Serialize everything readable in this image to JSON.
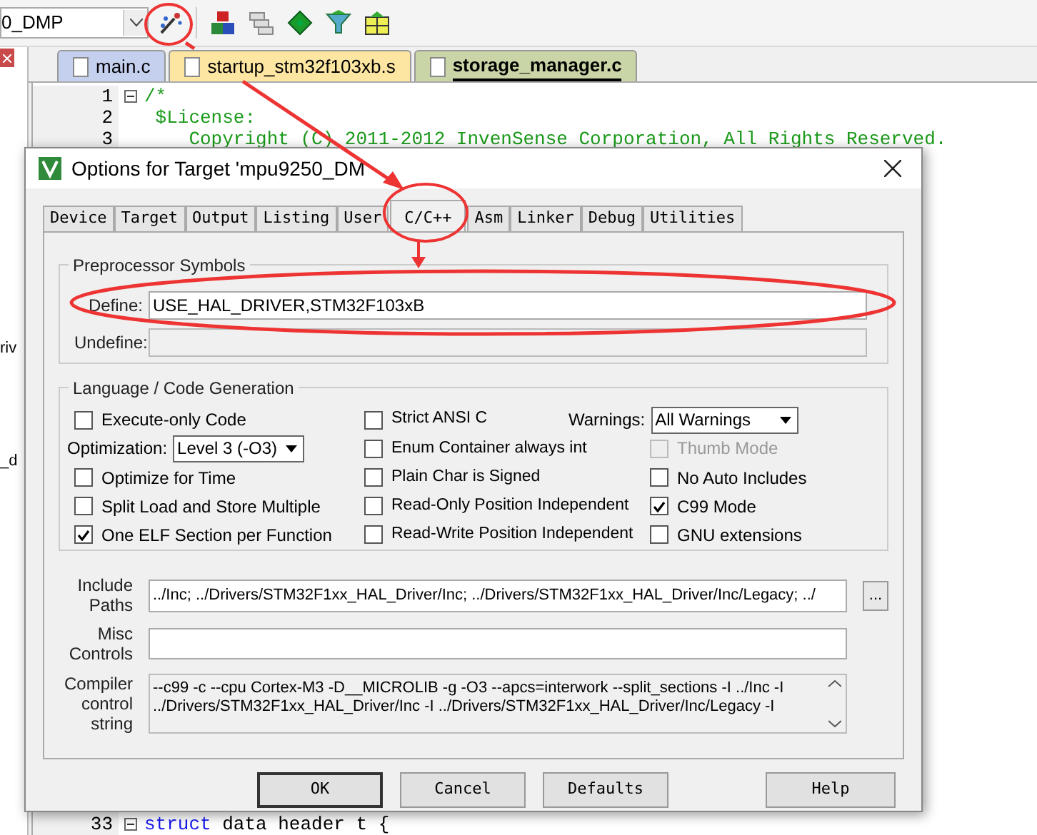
{
  "toolbar": {
    "target": "0_DMP"
  },
  "left_panel": {
    "fragments": [
      "riv",
      "_d"
    ]
  },
  "editor": {
    "tabs": [
      {
        "label": "main.c",
        "selected": false,
        "color": "#c5cfee"
      },
      {
        "label": "startup_stm32f103xb.s",
        "selected": false,
        "color": "#fde6a2"
      },
      {
        "label": "storage_manager.c",
        "selected": true,
        "color": "#c9d5a6"
      }
    ],
    "lines_top": [
      {
        "number": "1",
        "fold": true,
        "tokens": [
          {
            "text": "/*",
            "kind": "comment"
          }
        ]
      },
      {
        "number": "2",
        "fold": false,
        "tokens": [
          {
            "text": " $License:",
            "kind": "comment"
          }
        ]
      },
      {
        "number": "3",
        "fold": false,
        "tokens": [
          {
            "text": "    Copyright (C) 2011-2012 InvenSense Corporation, All Rights Reserved.",
            "kind": "comment"
          }
        ]
      }
    ],
    "lines_bottom": [
      {
        "number": "33",
        "fold": true,
        "tokens": [
          {
            "text": "struct",
            "kind": "keyword"
          },
          {
            "text": " data header t {",
            "kind": "plain"
          }
        ]
      }
    ]
  },
  "dialog": {
    "title": "Options for Target 'mpu9250_DM",
    "tabs": [
      {
        "label": "Device",
        "selected": false
      },
      {
        "label": "Target",
        "selected": false
      },
      {
        "label": "Output",
        "selected": false
      },
      {
        "label": "Listing",
        "selected": false
      },
      {
        "label": "User",
        "selected": false
      },
      {
        "label": "C/C++",
        "selected": true
      },
      {
        "label": "Asm",
        "selected": false
      },
      {
        "label": "Linker",
        "selected": false
      },
      {
        "label": "Debug",
        "selected": false
      },
      {
        "label": "Utilities",
        "selected": false
      }
    ],
    "preprocessor": {
      "title": "Preprocessor Symbols",
      "define_label": "Define:",
      "define_value": "USE_HAL_DRIVER,STM32F103xB",
      "undefine_label": "Undefine:"
    },
    "language": {
      "title": "Language / Code Generation",
      "columns": [
        [
          {
            "kind": "checkbox",
            "label": "Execute-only Code",
            "checked": false,
            "disabled": false
          },
          {
            "kind": "select",
            "label": "Optimization:",
            "value": "Level 3 (-O3)"
          },
          {
            "kind": "checkbox",
            "label": "Optimize for Time",
            "checked": false,
            "disabled": false
          },
          {
            "kind": "checkbox",
            "label": "Split Load and Store Multiple",
            "checked": false,
            "disabled": false
          },
          {
            "kind": "checkbox",
            "label": "One ELF Section per Function",
            "checked": true,
            "disabled": false
          }
        ],
        [
          {
            "kind": "checkbox",
            "label": "Strict ANSI C",
            "checked": false,
            "disabled": false
          },
          {
            "kind": "checkbox",
            "label": "Enum Container always int",
            "checked": false,
            "disabled": false
          },
          {
            "kind": "checkbox",
            "label": "Plain Char is Signed",
            "checked": false,
            "disabled": false
          },
          {
            "kind": "checkbox",
            "label": "Read-Only Position Independent",
            "checked": false,
            "disabled": false
          },
          {
            "kind": "checkbox",
            "label": "Read-Write Position Independent",
            "checked": false,
            "disabled": false
          }
        ],
        [
          {
            "kind": "select",
            "label": "Warnings:",
            "value": "All Warnings"
          },
          {
            "kind": "checkbox",
            "label": "Thumb Mode",
            "checked": false,
            "disabled": true
          },
          {
            "kind": "checkbox",
            "label": "No Auto Includes",
            "checked": false,
            "disabled": false
          },
          {
            "kind": "checkbox",
            "label": "C99 Mode",
            "checked": true,
            "disabled": false
          },
          {
            "kind": "checkbox",
            "label": "GNU extensions",
            "checked": false,
            "disabled": false
          }
        ]
      ]
    },
    "include": {
      "label_lines": [
        "Include",
        "Paths"
      ],
      "value": "../Inc;  ../Drivers/STM32F1xx_HAL_Driver/Inc;  ../Drivers/STM32F1xx_HAL_Driver/Inc/Legacy;  ../",
      "browse": "..."
    },
    "misc": {
      "label_lines": [
        "Misc",
        "Controls"
      ]
    },
    "compiler": {
      "label_lines": [
        "Compiler",
        "control",
        "string"
      ],
      "lines": [
        "--c99 -c --cpu Cortex-M3 -D__MICROLIB -g -O3 --apcs=interwork --split_sections -I ../Inc -I",
        "../Drivers/STM32F1xx_HAL_Driver/Inc -I ../Drivers/STM32F1xx_HAL_Driver/Inc/Legacy -I"
      ]
    },
    "buttons": [
      {
        "label": "OK",
        "kind": "default"
      },
      {
        "label": "Cancel",
        "kind": "normal"
      },
      {
        "label": "Defaults",
        "kind": "normal"
      },
      {
        "label": "Help",
        "kind": "help"
      }
    ]
  }
}
